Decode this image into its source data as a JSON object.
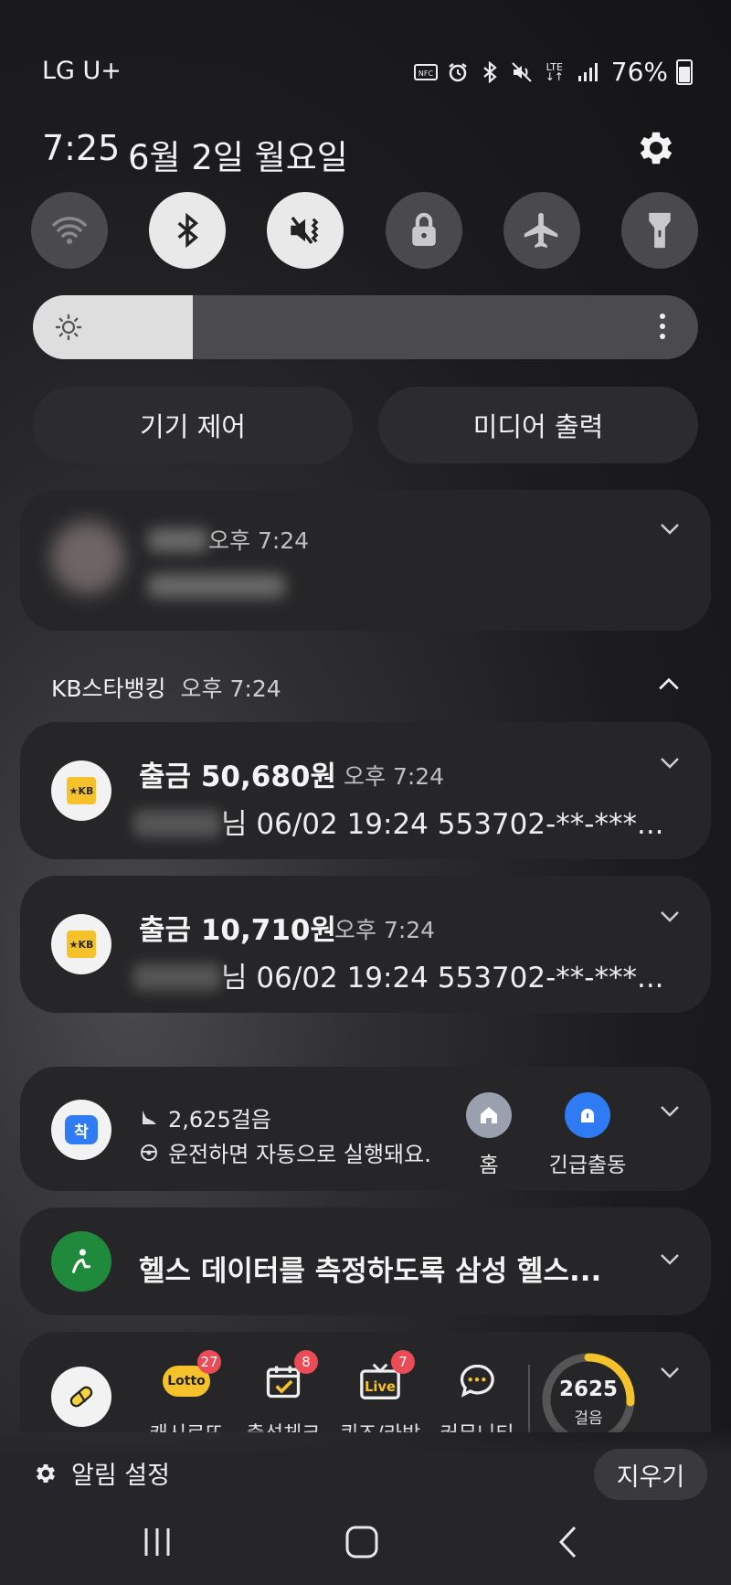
{
  "status_bar": {
    "carrier": "LG U+",
    "network": "LTE",
    "battery": "76%",
    "icons": [
      "nfc-icon",
      "alarm-icon",
      "bluetooth-icon",
      "mute-icon",
      "lte-icon",
      "signal-icon",
      "battery-icon"
    ]
  },
  "header": {
    "time": "7:25",
    "date": "6월 2일 월요일"
  },
  "quick_toggles": [
    {
      "name": "wifi",
      "on": false
    },
    {
      "name": "bluetooth",
      "on": true
    },
    {
      "name": "sound-mute",
      "on": true
    },
    {
      "name": "lock",
      "on": false
    },
    {
      "name": "airplane",
      "on": false
    },
    {
      "name": "flashlight",
      "on": false
    }
  ],
  "brightness": {
    "level": 0.24
  },
  "panel_buttons": {
    "device_control": "기기 제어",
    "media_output": "미디어 출력"
  },
  "notifications": {
    "blurred": {
      "time": "오후 7:24"
    },
    "kb_group": {
      "app": "KB스타뱅킹",
      "time": "오후 7:24",
      "items": [
        {
          "title": "출금 50,680원",
          "time": "오후 7:24",
          "body": "님 06/02 19:24 553702-**-***..."
        },
        {
          "title": "출금 10,710원",
          "time": "오후 7:24",
          "body": "님 06/02 19:24 553702-**-***..."
        }
      ]
    },
    "tmap": {
      "steps": "2,625걸음",
      "drive_text": "운전하면 자동으로 실행돼요.",
      "action_home": "홈",
      "action_emergency": "긴급출동"
    },
    "health": {
      "title": "헬스 데이터를 측정하도록 삼성 헬스..."
    },
    "cashwalk": {
      "items": [
        {
          "label": "캐시로또",
          "badge": "27"
        },
        {
          "label": "출석체크",
          "badge": "8"
        },
        {
          "label": "퀴즈/라방",
          "badge": "7"
        },
        {
          "label": "커뮤니티",
          "badge": ""
        }
      ],
      "steps": "2625",
      "steps_unit": "걸음",
      "progress": 0.26
    }
  },
  "footer": {
    "notification_settings": "알림 설정",
    "clear": "지우기"
  }
}
